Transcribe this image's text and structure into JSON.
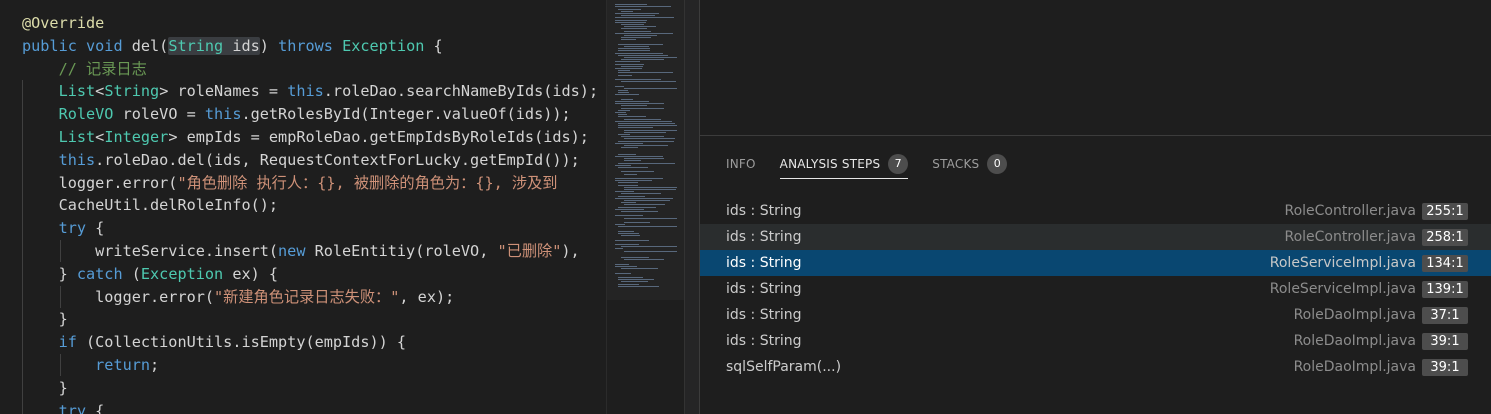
{
  "code": {
    "lines": [
      [
        {
          "t": "@Override",
          "c": "t-ann"
        }
      ],
      [
        {
          "t": "public ",
          "c": "t-kw"
        },
        {
          "t": "void ",
          "c": "t-kw"
        },
        {
          "t": "del(",
          "c": "t-plain"
        },
        {
          "t": "String ids",
          "c": "t-hl-group"
        },
        {
          "t": ") ",
          "c": "t-plain"
        },
        {
          "t": "throws ",
          "c": "t-kw"
        },
        {
          "t": "Exception",
          "c": "t-type"
        },
        {
          "t": " {",
          "c": "t-plain"
        }
      ],
      [
        {
          "t": "    ",
          "c": "t-plain"
        },
        {
          "t": "// 记录日志",
          "c": "t-cmt"
        }
      ],
      [
        {
          "t": "    ",
          "c": "t-plain"
        },
        {
          "t": "List",
          "c": "t-type"
        },
        {
          "t": "<",
          "c": "t-plain"
        },
        {
          "t": "String",
          "c": "t-type"
        },
        {
          "t": "> roleNames = ",
          "c": "t-plain"
        },
        {
          "t": "this",
          "c": "t-kw"
        },
        {
          "t": ".roleDao.searchNameByIds(ids);",
          "c": "t-plain"
        }
      ],
      [
        {
          "t": "    ",
          "c": "t-plain"
        },
        {
          "t": "RoleVO",
          "c": "t-type"
        },
        {
          "t": " roleVO = ",
          "c": "t-plain"
        },
        {
          "t": "this",
          "c": "t-kw"
        },
        {
          "t": ".getRolesById(Integer.valueOf(ids));",
          "c": "t-plain"
        }
      ],
      [
        {
          "t": "    ",
          "c": "t-plain"
        },
        {
          "t": "List",
          "c": "t-type"
        },
        {
          "t": "<",
          "c": "t-plain"
        },
        {
          "t": "Integer",
          "c": "t-type"
        },
        {
          "t": "> empIds = empRoleDao.getEmpIdsByRoleIds(ids);",
          "c": "t-plain"
        }
      ],
      [
        {
          "t": "    ",
          "c": "t-plain"
        },
        {
          "t": "this",
          "c": "t-kw"
        },
        {
          "t": ".roleDao.del(ids, RequestContextForLucky.getEmpId());",
          "c": "t-plain"
        }
      ],
      [
        {
          "t": "    logger.error(",
          "c": "t-plain"
        },
        {
          "t": "\"角色删除 执行人：{}, 被删除的角色为：{}, 涉及到",
          "c": "t-str"
        }
      ],
      [
        {
          "t": "    CacheUtil.delRoleInfo();",
          "c": "t-plain"
        }
      ],
      [
        {
          "t": "    ",
          "c": "t-plain"
        },
        {
          "t": "try",
          "c": "t-kw"
        },
        {
          "t": " {",
          "c": "t-plain"
        }
      ],
      [
        {
          "t": "        writeService.insert(",
          "c": "t-plain"
        },
        {
          "t": "new ",
          "c": "t-kw"
        },
        {
          "t": "RoleEntitiy(roleVO, ",
          "c": "t-plain"
        },
        {
          "t": "\"已删除\"",
          "c": "t-str"
        },
        {
          "t": "),",
          "c": "t-plain"
        }
      ],
      [
        {
          "t": "    } ",
          "c": "t-plain"
        },
        {
          "t": "catch",
          "c": "t-kw"
        },
        {
          "t": " (",
          "c": "t-plain"
        },
        {
          "t": "Exception",
          "c": "t-type"
        },
        {
          "t": " ex) {",
          "c": "t-plain"
        }
      ],
      [
        {
          "t": "        logger.error(",
          "c": "t-plain"
        },
        {
          "t": "\"新建角色记录日志失败：\"",
          "c": "t-str"
        },
        {
          "t": ", ex);",
          "c": "t-plain"
        }
      ],
      [
        {
          "t": "    }",
          "c": "t-plain"
        }
      ],
      [
        {
          "t": "    ",
          "c": "t-plain"
        },
        {
          "t": "if",
          "c": "t-kw"
        },
        {
          "t": " (CollectionUtils.isEmpty(empIds)) {",
          "c": "t-plain"
        }
      ],
      [
        {
          "t": "        ",
          "c": "t-plain"
        },
        {
          "t": "return",
          "c": "t-kw"
        },
        {
          "t": ";",
          "c": "t-plain"
        }
      ],
      [
        {
          "t": "    }",
          "c": "t-plain"
        }
      ],
      [
        {
          "t": "    ",
          "c": "t-plain"
        },
        {
          "t": "try",
          "c": "t-kw"
        },
        {
          "t": " {",
          "c": "t-plain"
        }
      ]
    ]
  },
  "panel": {
    "tabs": [
      {
        "label": "INFO",
        "active": false,
        "badge": null
      },
      {
        "label": "ANALYSIS STEPS",
        "active": true,
        "badge": "7"
      },
      {
        "label": "STACKS",
        "active": false,
        "badge": "0"
      }
    ],
    "steps": [
      {
        "label": "ids : String",
        "file": "RoleController.java",
        "pos": "255:1",
        "state": ""
      },
      {
        "label": "ids : String",
        "file": "RoleController.java",
        "pos": "258:1",
        "state": "hover"
      },
      {
        "label": "ids : String",
        "file": "RoleServiceImpl.java",
        "pos": "134:1",
        "state": "selected"
      },
      {
        "label": "ids : String",
        "file": "RoleServiceImpl.java",
        "pos": "139:1",
        "state": ""
      },
      {
        "label": "ids : String",
        "file": "RoleDaoImpl.java",
        "pos": "37:1",
        "state": ""
      },
      {
        "label": "ids : String",
        "file": "RoleDaoImpl.java",
        "pos": "39:1",
        "state": ""
      },
      {
        "label": "sqlSelfParam(...)",
        "file": "RoleDaoImpl.java",
        "pos": "39:1",
        "state": ""
      }
    ]
  }
}
